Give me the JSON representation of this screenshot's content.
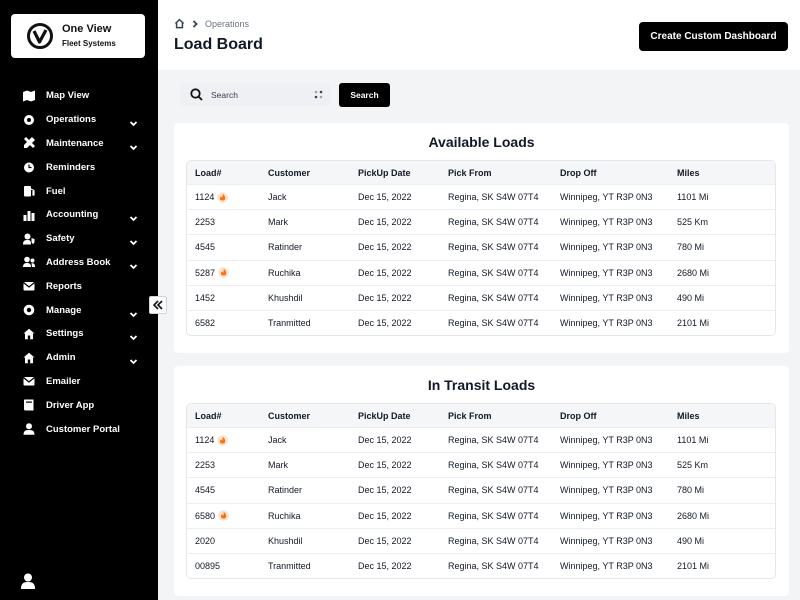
{
  "brand": {
    "name": "One View",
    "subtitle": "Fleet Systems"
  },
  "nav": [
    {
      "label": "Map View",
      "icon": "map-icon",
      "chevron": false
    },
    {
      "label": "Operations",
      "icon": "gear-icon",
      "chevron": true
    },
    {
      "label": "Maintenance",
      "icon": "tools-icon",
      "chevron": true
    },
    {
      "label": "Reminders",
      "icon": "alarm-icon",
      "chevron": false
    },
    {
      "label": "Fuel",
      "icon": "fuel-icon",
      "chevron": false
    },
    {
      "label": "Accounting",
      "icon": "bar-chart-icon",
      "chevron": true
    },
    {
      "label": "Safety",
      "icon": "user-shield-icon",
      "chevron": true
    },
    {
      "label": "Address Book",
      "icon": "contacts-icon",
      "chevron": true
    },
    {
      "label": "Reports",
      "icon": "mail-icon",
      "chevron": false
    },
    {
      "label": "Manage",
      "icon": "settings-icon",
      "chevron": true
    },
    {
      "label": "Settings",
      "icon": "home-icon",
      "chevron": true
    },
    {
      "label": "Admin",
      "icon": "admin-home-icon",
      "chevron": true
    },
    {
      "label": "Emailer",
      "icon": "envelope-icon",
      "chevron": false
    },
    {
      "label": "Driver App",
      "icon": "book-icon",
      "chevron": false
    },
    {
      "label": "Customer Portal",
      "icon": "person-icon",
      "chevron": false
    }
  ],
  "header": {
    "breadcrumb": "Operations",
    "title": "Load Board",
    "create_label": "Create Custom Dashboard"
  },
  "search": {
    "placeholder": "Search",
    "button_label": "Search"
  },
  "columns": [
    "Load#",
    "Customer",
    "PickUp Date",
    "Pick From",
    "Drop Off",
    "Miles"
  ],
  "available": {
    "title": "Available Loads",
    "rows": [
      {
        "load": "1124",
        "hot": true,
        "customer": "Jack",
        "date": "Dec 15, 2022",
        "from": "Regina, SK S4W 07T4",
        "to": "Winnipeg, YT R3P 0N3",
        "miles": "1101 Mi"
      },
      {
        "load": "2253",
        "hot": false,
        "customer": "Mark",
        "date": "Dec 15, 2022",
        "from": "Regina, SK S4W 07T4",
        "to": "Winnipeg, YT R3P 0N3",
        "miles": "525 Km"
      },
      {
        "load": "4545",
        "hot": false,
        "customer": "Ratinder",
        "date": "Dec 15, 2022",
        "from": "Regina, SK S4W 07T4",
        "to": "Winnipeg, YT R3P 0N3",
        "miles": "780 Mi"
      },
      {
        "load": "5287",
        "hot": true,
        "customer": "Ruchika",
        "date": "Dec 15, 2022",
        "from": "Regina, SK S4W 07T4",
        "to": "Winnipeg, YT R3P 0N3",
        "miles": "2680 Mi"
      },
      {
        "load": "1452",
        "hot": false,
        "customer": "Khushdil",
        "date": "Dec 15, 2022",
        "from": "Regina, SK S4W 07T4",
        "to": "Winnipeg, YT R3P 0N3",
        "miles": "490 Mi"
      },
      {
        "load": "6582",
        "hot": false,
        "customer": "Tranmitted",
        "date": "Dec 15, 2022",
        "from": "Regina, SK S4W 07T4",
        "to": "Winnipeg, YT R3P 0N3",
        "miles": "2101 Mi"
      }
    ]
  },
  "transit": {
    "title": "In Transit Loads",
    "rows": [
      {
        "load": "1124",
        "hot": true,
        "customer": "Jack",
        "date": "Dec 15, 2022",
        "from": "Regina, SK S4W 07T4",
        "to": "Winnipeg, YT R3P 0N3",
        "miles": "1101 Mi"
      },
      {
        "load": "2253",
        "hot": false,
        "customer": "Mark",
        "date": "Dec 15, 2022",
        "from": "Regina, SK S4W 07T4",
        "to": "Winnipeg, YT R3P 0N3",
        "miles": "525 Km"
      },
      {
        "load": "4545",
        "hot": false,
        "customer": "Ratinder",
        "date": "Dec 15, 2022",
        "from": "Regina, SK S4W 07T4",
        "to": "Winnipeg, YT R3P 0N3",
        "miles": "780 Mi"
      },
      {
        "load": "6580",
        "hot": true,
        "customer": "Ruchika",
        "date": "Dec 15, 2022",
        "from": "Regina, SK S4W 07T4",
        "to": "Winnipeg, YT R3P 0N3",
        "miles": "2680 Mi"
      },
      {
        "load": "2020",
        "hot": false,
        "customer": "Khushdil",
        "date": "Dec 15, 2022",
        "from": "Regina, SK S4W 07T4",
        "to": "Winnipeg, YT R3P 0N3",
        "miles": "490 Mi"
      },
      {
        "load": "00895",
        "hot": false,
        "customer": "Tranmitted",
        "date": "Dec 15, 2022",
        "from": "Regina, SK S4W 07T4",
        "to": "Winnipeg, YT R3P 0N3",
        "miles": "2101 Mi"
      }
    ]
  },
  "colors": {
    "sidebar": "#000000",
    "accent": "#000000",
    "fire": "#f97316"
  }
}
